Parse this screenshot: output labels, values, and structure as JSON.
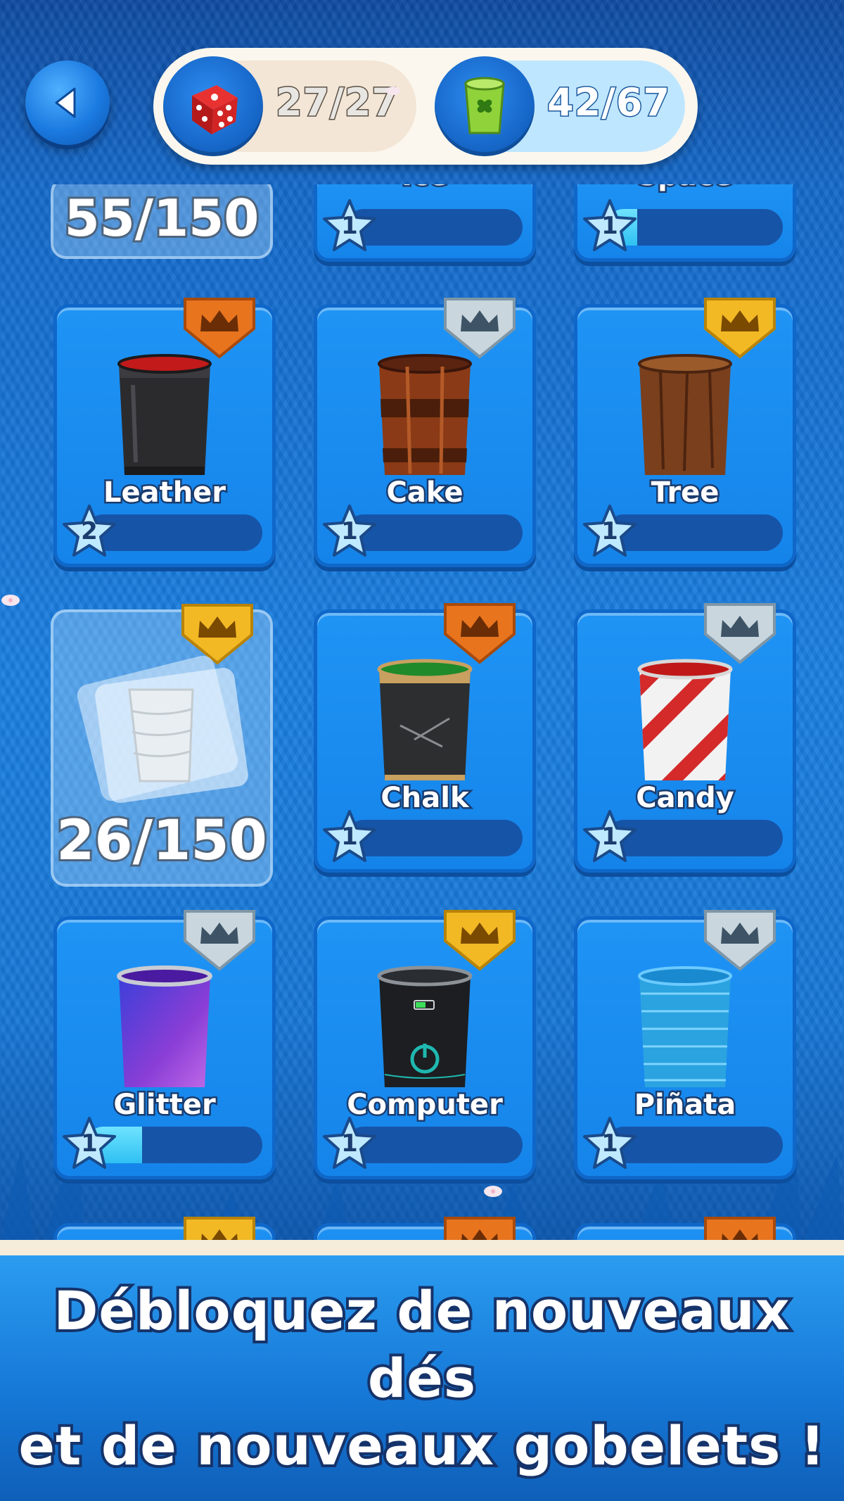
{
  "header": {
    "back_label": "Back",
    "dice_count": "27/27",
    "cup_count": "42/67"
  },
  "cards": [
    {
      "id": "locked-top",
      "locked": true,
      "count": "55/150"
    },
    {
      "id": "ice",
      "name": "Ice",
      "level": "1",
      "progress": 0,
      "partial": true
    },
    {
      "id": "space",
      "name": "Space",
      "level": "1",
      "progress": 0.18,
      "partial": true
    },
    {
      "id": "leather",
      "name": "Leather",
      "level": "2",
      "progress": 0,
      "crown": "bronze"
    },
    {
      "id": "cake",
      "name": "Cake",
      "level": "1",
      "progress": 0,
      "crown": "silver"
    },
    {
      "id": "tree",
      "name": "Tree",
      "level": "1",
      "progress": 0,
      "crown": "gold"
    },
    {
      "id": "locked-mid",
      "locked": true,
      "count": "26/150",
      "crown": "gold"
    },
    {
      "id": "chalk",
      "name": "Chalk",
      "level": "1",
      "progress": 0,
      "crown": "bronze"
    },
    {
      "id": "candy",
      "name": "Candy",
      "level": "1",
      "progress": 0,
      "crown": "silver"
    },
    {
      "id": "glitter",
      "name": "Glitter",
      "level": "1",
      "progress": 0.32,
      "crown": "silver"
    },
    {
      "id": "computer",
      "name": "Computer",
      "level": "1",
      "progress": 0,
      "crown": "gold"
    },
    {
      "id": "pinata",
      "name": "Piñata",
      "level": "1",
      "progress": 0,
      "crown": "silver"
    }
  ],
  "banner": {
    "line1": "Débloquez de nouveaux dés",
    "line2": "et de nouveaux gobelets !"
  },
  "colors": {
    "crown_gold": "#f2b925",
    "crown_silver": "#c9d6de",
    "crown_bronze": "#e8741e",
    "card_blue": "#1f94f5",
    "progress_fill": "#2fc0f2"
  }
}
